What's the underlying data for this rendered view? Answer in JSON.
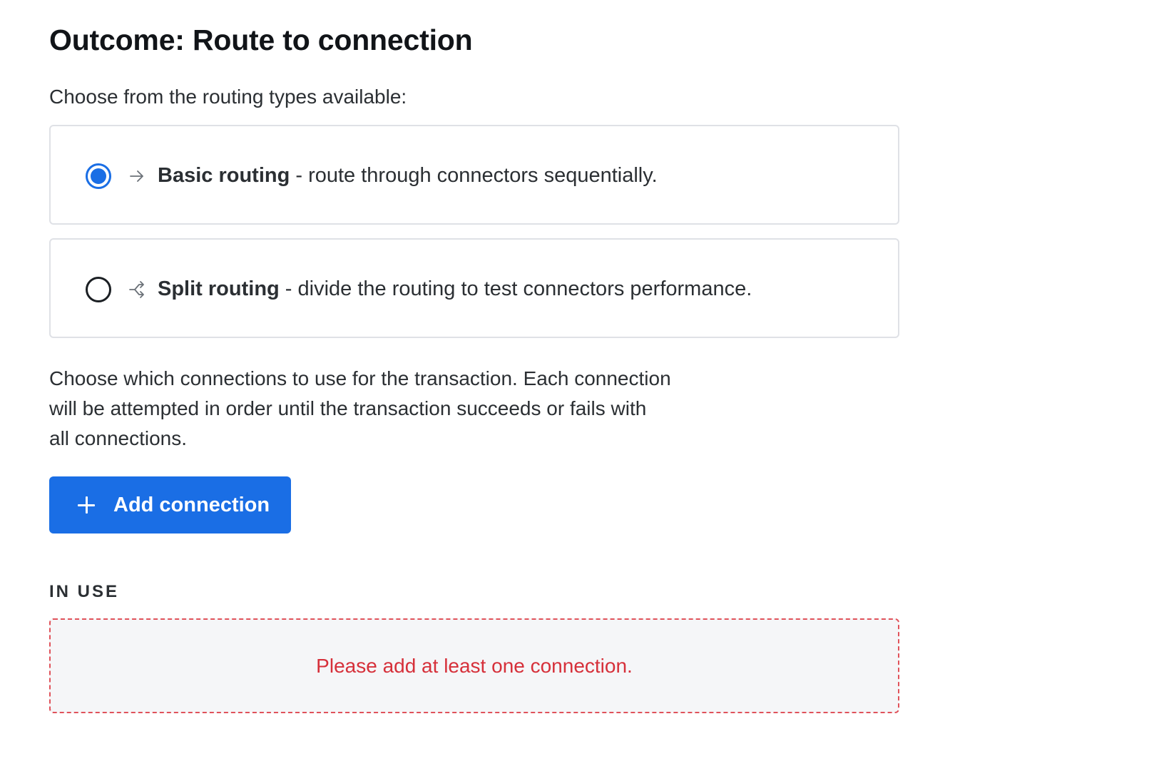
{
  "title": "Outcome: Route to connection",
  "subtitle": "Choose from the routing types available:",
  "routing_options": [
    {
      "name": "Basic routing",
      "description": " - route through connectors sequentially.",
      "selected": true,
      "icon": "arrow-right-icon"
    },
    {
      "name": "Split routing",
      "description": " - divide the routing to test connectors performance.",
      "selected": false,
      "icon": "split-arrows-icon"
    }
  ],
  "description_lines": [
    "Choose which connections to use for the transaction. Each connection",
    "will be attempted in order until the transaction succeeds or fails with",
    "all connections."
  ],
  "add_button": {
    "label": "Add connection",
    "icon": "plus-icon"
  },
  "in_use": {
    "label": "IN USE",
    "empty_message": "Please add at least one connection."
  },
  "colors": {
    "accent": "#1a6ee5",
    "error": "#d6303a",
    "error_border": "#e0525a",
    "empty_bg": "#f5f6f8"
  }
}
